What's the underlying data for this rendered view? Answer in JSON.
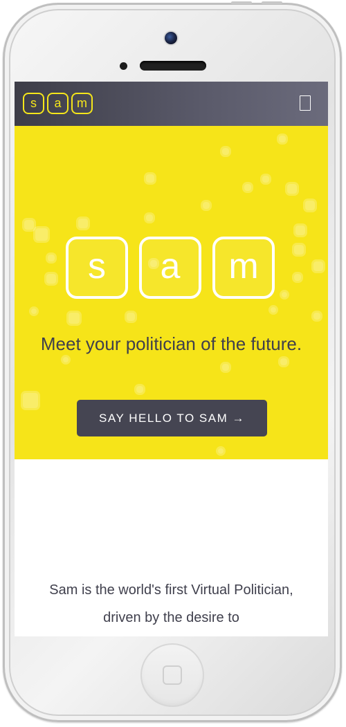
{
  "navbar": {
    "logo_letters": [
      "s",
      "a",
      "m"
    ],
    "menu_icon": "menu-icon"
  },
  "hero": {
    "logo_letters": [
      "s",
      "a",
      "m"
    ],
    "tagline": "Meet your politician of the future.",
    "cta_label": "SAY HELLO TO SAM →"
  },
  "intro": {
    "text": "Sam is the world's first Virtual Politician, driven by the desire to"
  },
  "colors": {
    "accent_yellow": "#f6e419",
    "navbar_dark": "#454552",
    "text_dark": "#3f3f4c"
  }
}
